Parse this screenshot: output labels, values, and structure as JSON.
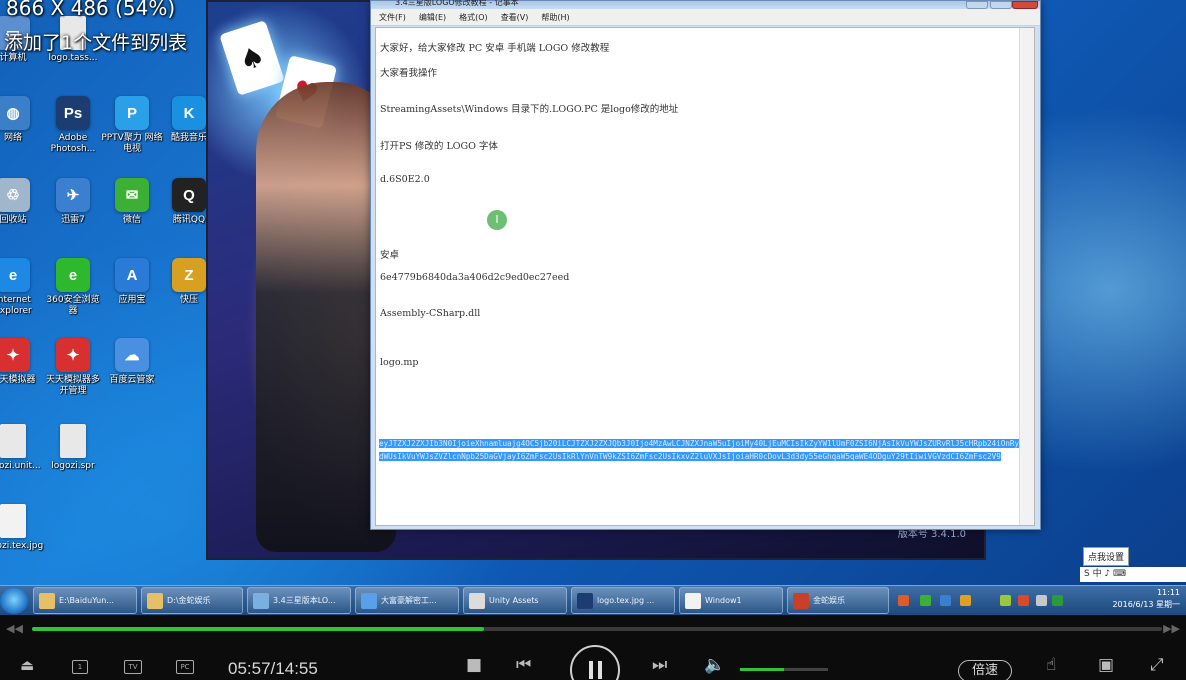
{
  "overlay": {
    "video_info": "866 X 486 (54%)",
    "notification": "添加了1个文件到列表"
  },
  "desktop_icons": [
    {
      "label": "计算机",
      "icon": "computer-icon",
      "color": "#5b8fd0"
    },
    {
      "label": "logo.tass...",
      "icon": "file-icon",
      "color": "#e8e8e8"
    },
    {
      "label": "网络",
      "icon": "network-icon",
      "color": "#3b7fc8"
    },
    {
      "label": "Adobe Photosh...",
      "icon": "photoshop-icon",
      "color": "#1d3d72"
    },
    {
      "label": "PPTV聚力 网络电视",
      "icon": "pptv-icon",
      "color": "#2aa0e8"
    },
    {
      "label": "酷我音乐",
      "icon": "kuwo-icon",
      "color": "#1a90e0"
    },
    {
      "label": "回收站",
      "icon": "recycle-bin-icon",
      "color": "#9fb6cc"
    },
    {
      "label": "迅雷7",
      "icon": "thunder-icon",
      "color": "#3a7fd0"
    },
    {
      "label": "微信",
      "icon": "wechat-icon",
      "color": "#3cb034"
    },
    {
      "label": "腾讯QQ",
      "icon": "qq-icon",
      "color": "#222222"
    },
    {
      "label": "Internet Explorer",
      "icon": "ie-icon",
      "color": "#1e88e5"
    },
    {
      "label": "360安全浏览器",
      "icon": "360-browser-icon",
      "color": "#2eb82e"
    },
    {
      "label": "应用宝",
      "icon": "app-store-icon",
      "color": "#2a7ad8"
    },
    {
      "label": "快压",
      "icon": "archive-icon",
      "color": "#d8a020"
    },
    {
      "label": "天天模拟器",
      "icon": "emulator-icon",
      "color": "#d83030"
    },
    {
      "label": "天天模拟器多开管理",
      "icon": "emulator-multi-icon",
      "color": "#d83030"
    },
    {
      "label": "百度云管家",
      "icon": "baidu-cloud-icon",
      "color": "#4a90e2"
    },
    {
      "label": "logozi.unit...",
      "icon": "file-icon",
      "color": "#e8e8e8"
    },
    {
      "label": "logozi.spr",
      "icon": "file-icon",
      "color": "#e8e8e8"
    },
    {
      "label": "logozi.tex.jpg",
      "icon": "image-icon",
      "color": "#f2f2f2"
    }
  ],
  "game_window": {
    "version": "版本号 3.4.1.0"
  },
  "notepad": {
    "title": "3.4三星版LOGO修改教程 - 记事本",
    "menus": [
      "文件(F)",
      "编辑(E)",
      "格式(O)",
      "查看(V)",
      "帮助(H)"
    ],
    "lines": [
      "大家好，给大家修改 PC 安卓  手机端 LOGO 修改教程",
      "大家看我操作",
      "StreamingAssets\\Windows   目录下的.LOGO.PC  是logo修改的地址",
      "打开PS 修改的 LOGO 字体",
      "d.6S0E2.0",
      "安卓",
      "6e4779b6840da3a406d2c9ed0ec27eed",
      "Assembly-CSharp.dll",
      "logo.mp"
    ],
    "selected_text": "eyJTZXJ2ZXJIb3N0IjoieXhnamluajg4OC5jb20iLCJTZXJ2ZXJQb3J0Ijo4MzAwLCJNZXJnaW5uIjoiMy40LjEuMCIsIkZyYW1lUmF0ZSI6NjAsIkVuYWJsZURvRlJ5cHRpb24iOnRydWUsIkVuYWJsZVZlcnNpb25DaGVjayI6ZmFsc2UsIkRlYnVnTW9kZSI6ZmFsc2UsIkxvZ2luVXJsIjoiaHR0cDovL3d3dy55eGhqaW5qaWE4ODguY29tIiwiVGVzdCI6ZmFsc2V9",
    "status": "版本号3.4.1.0"
  },
  "cursor_marker": "I",
  "taskbar": {
    "buttons": [
      {
        "label": "E:\\BaiduYun...",
        "icon": "folder-icon",
        "color": "#e6c067"
      },
      {
        "label": "D:\\金蛇娱乐",
        "icon": "folder-icon",
        "color": "#e6c067"
      },
      {
        "label": "3.4三星版本LO...",
        "icon": "notepad-icon",
        "color": "#7ab0e0"
      },
      {
        "label": "大富豪解密工...",
        "icon": "tool-icon",
        "color": "#5aa0e8"
      },
      {
        "label": "Unity Assets",
        "icon": "window-icon",
        "color": "#dcdcdc"
      },
      {
        "label": "logo.tex.jpg ...",
        "icon": "photoshop-icon",
        "color": "#1d3d72"
      },
      {
        "label": "Window1",
        "icon": "file-icon",
        "color": "#f2f2f2"
      },
      {
        "label": "金蛇娱乐",
        "icon": "game-icon",
        "color": "#c8402a"
      }
    ],
    "tray_settings": "点我设置",
    "ime": "S 中 ♪ ⌨",
    "time": "11:11",
    "date": "2016/6/13 星期一"
  },
  "player": {
    "current_time": "05:57",
    "total_time": "14:55",
    "time_separator": "/",
    "progress": 0.4,
    "volume": 0.5,
    "speed_label": "倍速",
    "box1": "1",
    "box2": "TV",
    "box3": "PC"
  }
}
